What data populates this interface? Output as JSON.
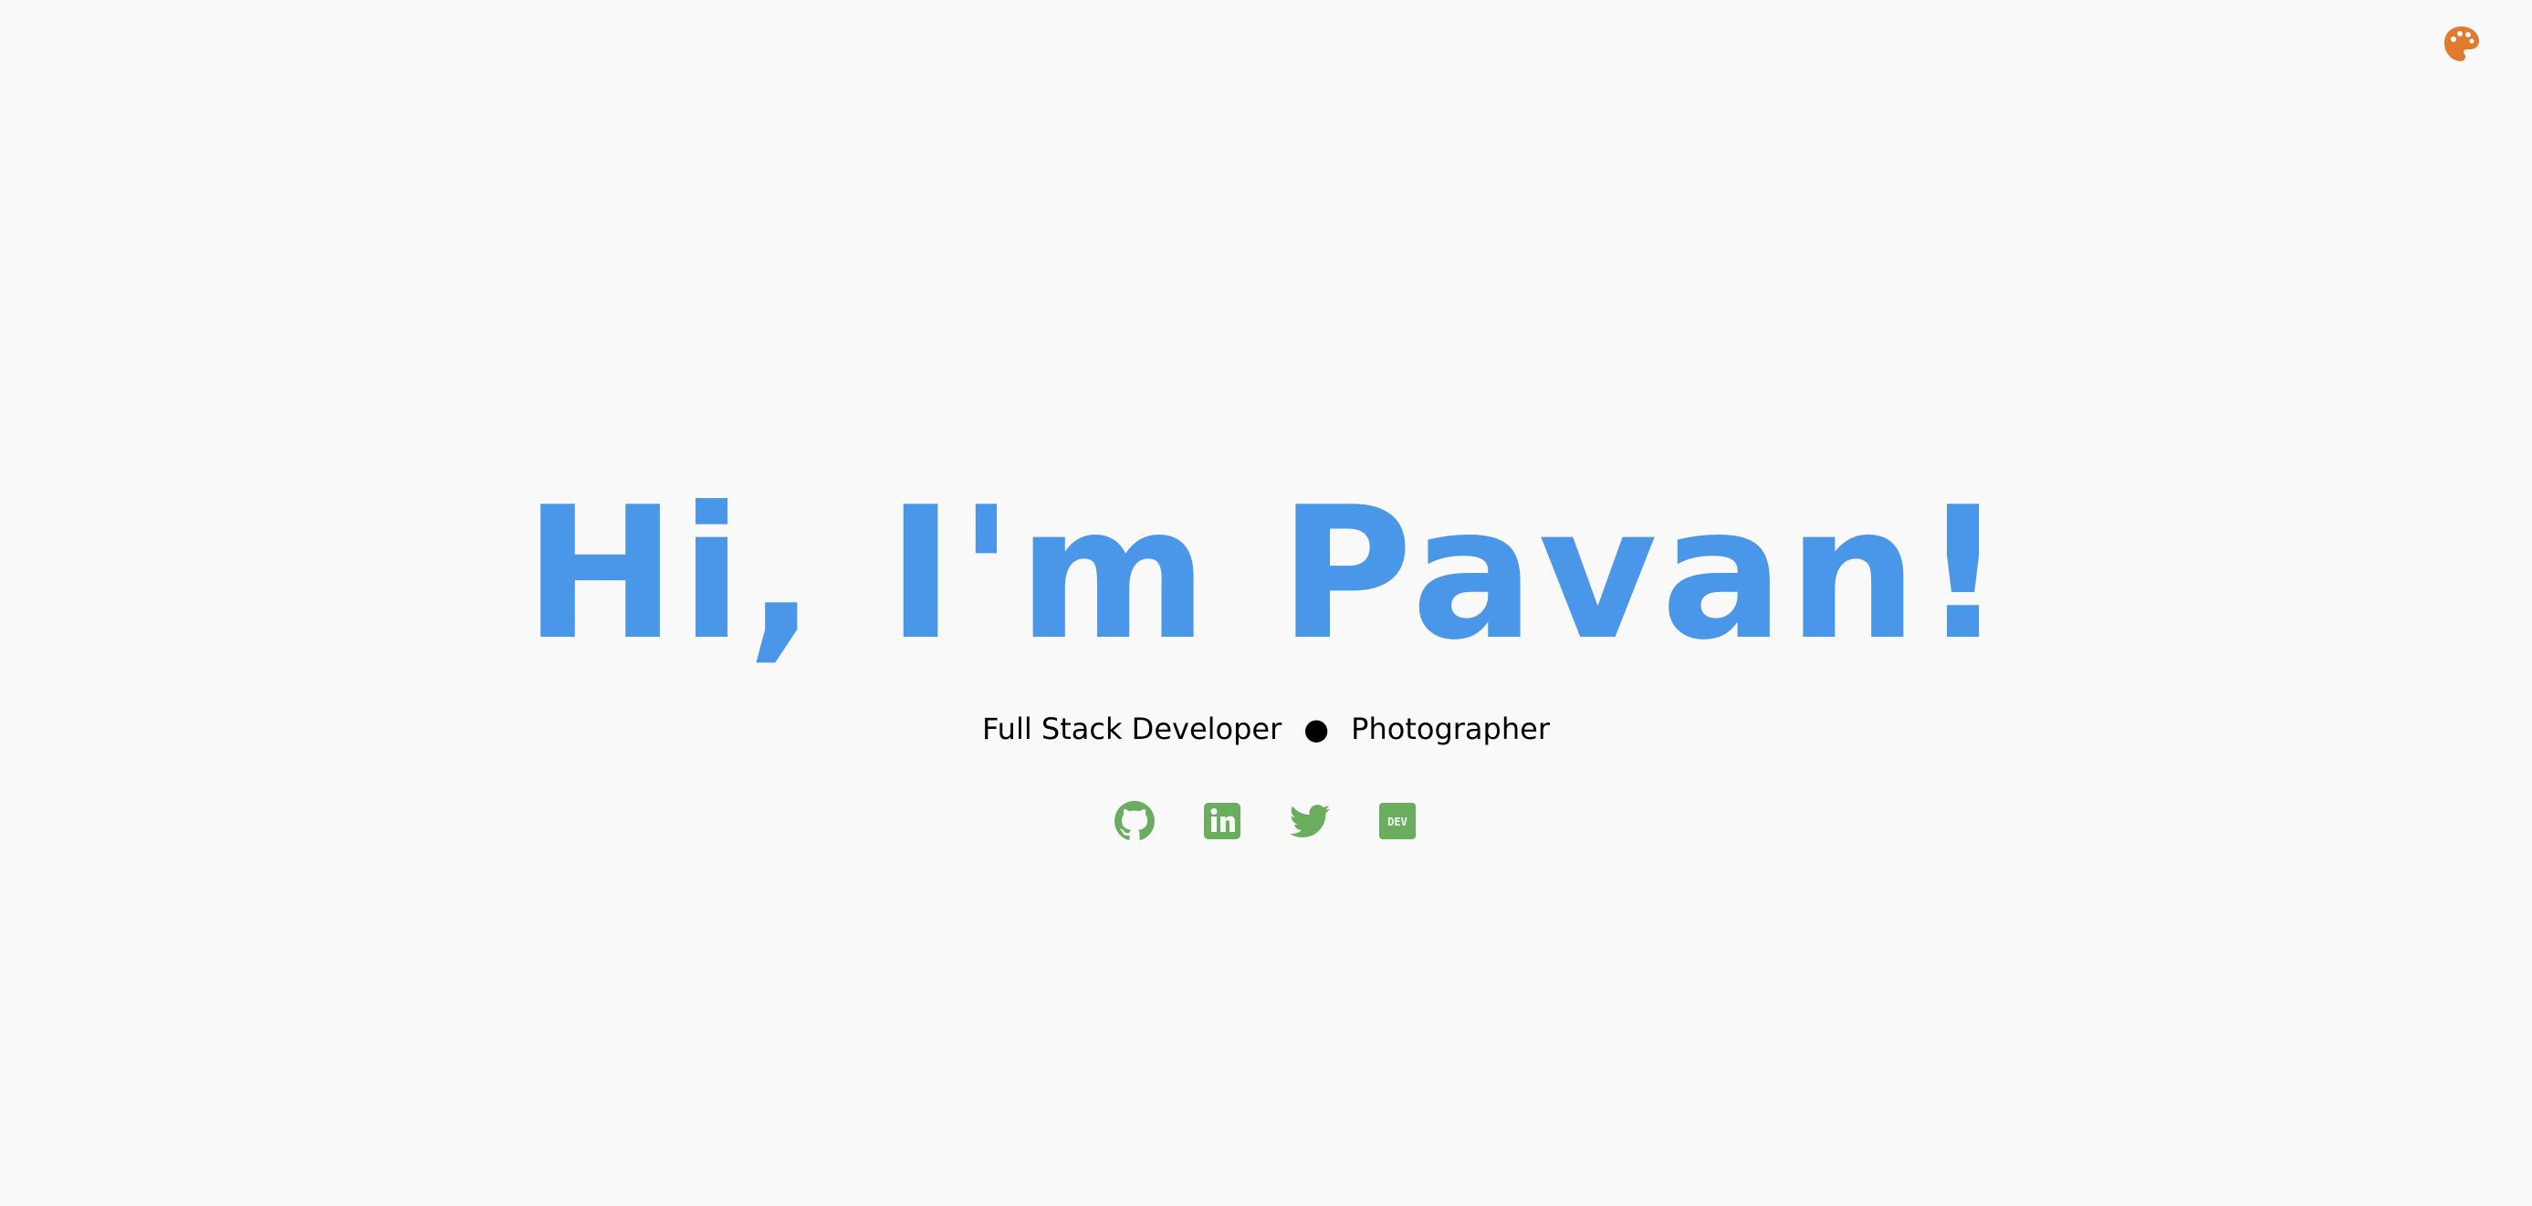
{
  "theme_toggle": {
    "icon": "palette-icon",
    "color": "#e07a2e"
  },
  "hero": {
    "title": "Hi, I'm Pavan!",
    "title_color": "#4a96e8",
    "roles": [
      "Full Stack Developer",
      "Photographer"
    ],
    "separator": "●"
  },
  "socials": {
    "color": "#6aad5f",
    "items": [
      {
        "icon": "github-icon"
      },
      {
        "icon": "linkedin-icon"
      },
      {
        "icon": "twitter-icon"
      },
      {
        "icon": "dev-icon",
        "label": "DEV"
      }
    ]
  }
}
